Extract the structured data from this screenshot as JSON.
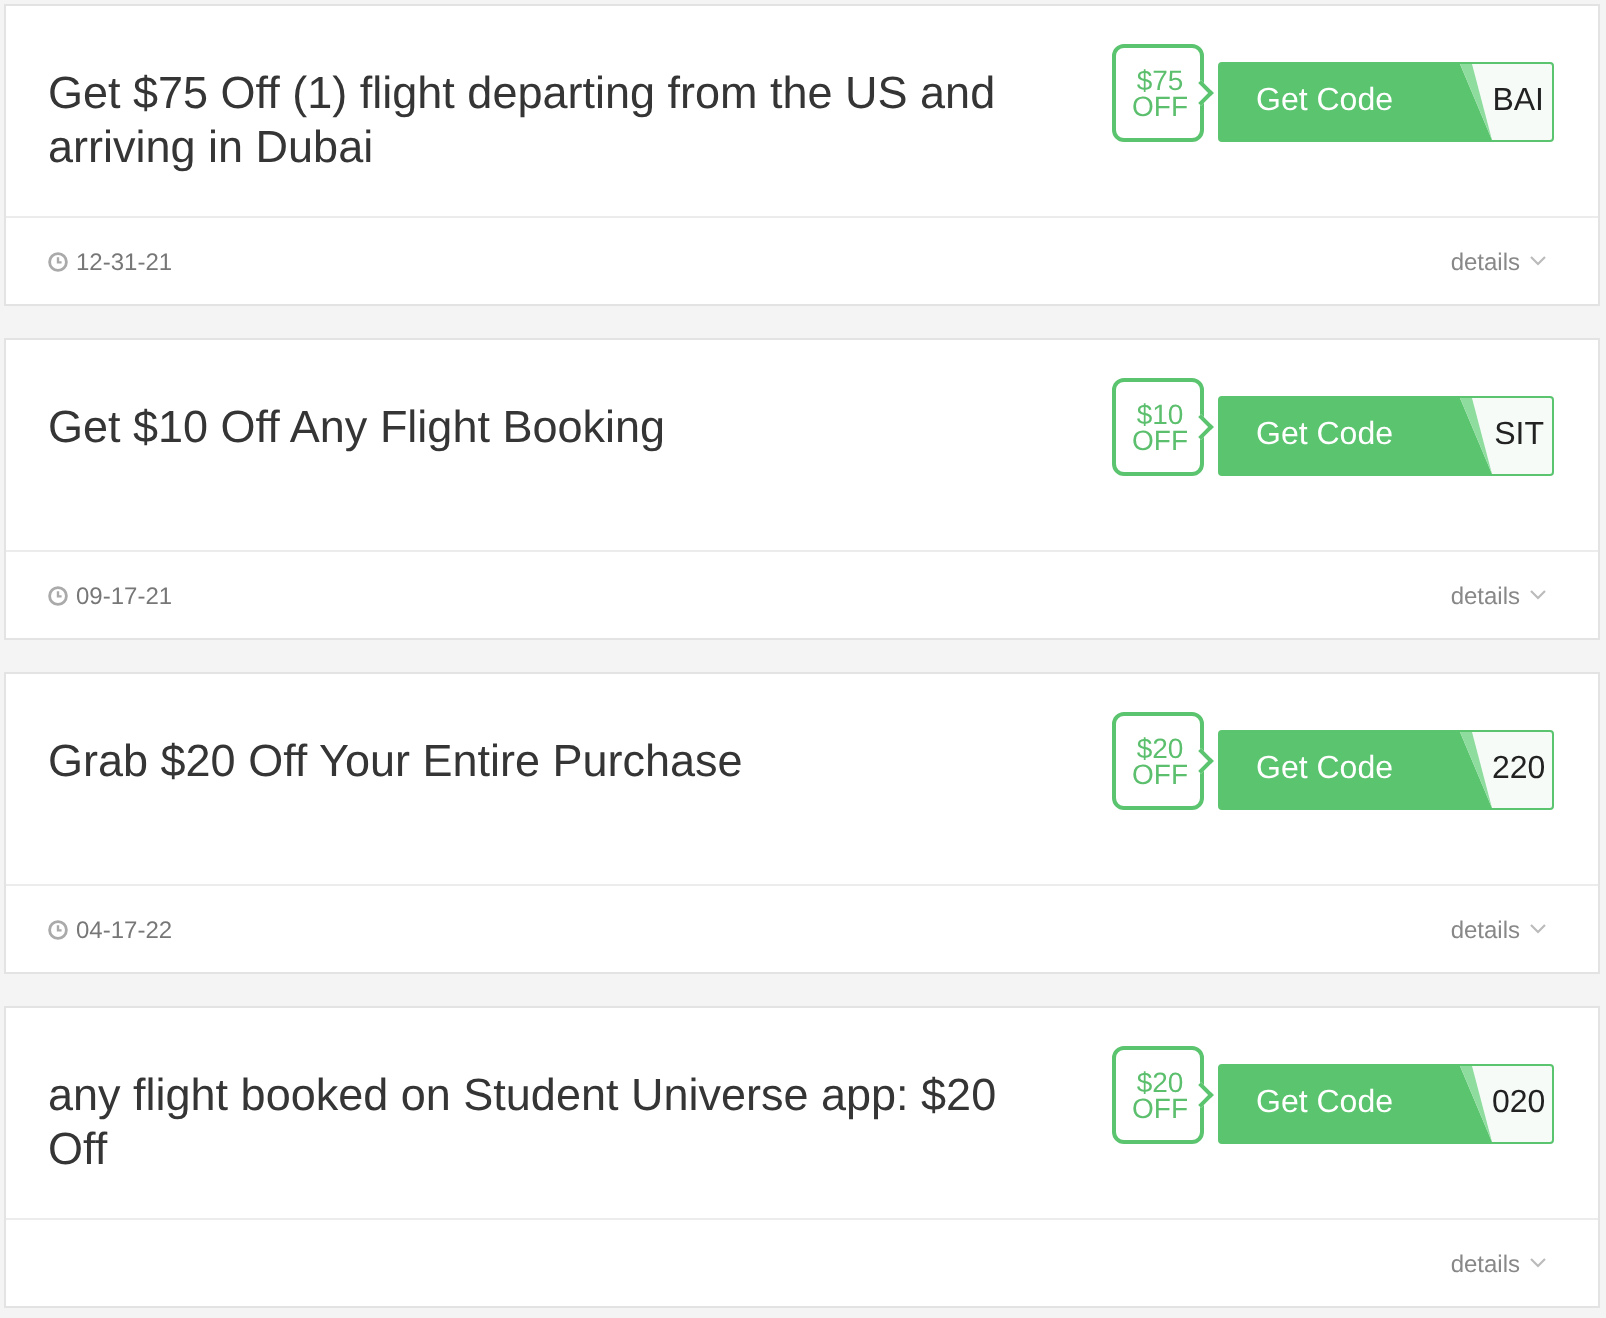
{
  "coupons": [
    {
      "title": "Get $75 Off (1) flight departing from the US and arriving in Dubai",
      "badge": "$75 OFF",
      "button_label": "Get Code",
      "code_peek": "BAI",
      "expiry": "12-31-21",
      "details_label": "details"
    },
    {
      "title": "Get $10 Off Any Flight Booking",
      "badge": "$10 OFF",
      "button_label": "Get Code",
      "code_peek": "SIT",
      "expiry": "09-17-21",
      "details_label": "details"
    },
    {
      "title": "Grab $20 Off Your Entire Purchase",
      "badge": "$20 OFF",
      "button_label": "Get Code",
      "code_peek": "220",
      "expiry": "04-17-22",
      "details_label": "details"
    },
    {
      "title": "any flight booked on Student Universe app: $20 Off",
      "badge": "$20 OFF",
      "button_label": "Get Code",
      "code_peek": "020",
      "details_label": "details"
    }
  ]
}
